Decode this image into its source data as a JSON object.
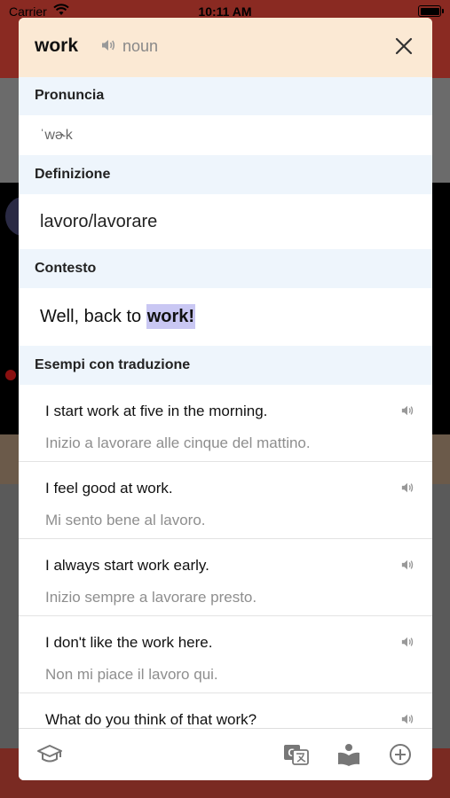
{
  "status_bar": {
    "carrier": "Carrier",
    "time": "10:11 AM"
  },
  "popup": {
    "word": "work",
    "part_of_speech": "noun",
    "sections": {
      "pronunciation_heading": "Pronuncia",
      "pronunciation": "ˈwɚk",
      "definition_heading": "Definizione",
      "definition": "lavoro/lavorare",
      "context_heading": "Contesto",
      "context_prefix": "Well, back to ",
      "context_highlight": "work!",
      "examples_heading": "Esempi con traduzione"
    },
    "examples": [
      {
        "en": "I start work at five in the morning.",
        "it": "Inizio a lavorare alle cinque del mattino."
      },
      {
        "en": "I feel good at work.",
        "it": "Mi sento bene al lavoro."
      },
      {
        "en": "I always start work early.",
        "it": "Inizio sempre a lavorare presto."
      },
      {
        "en": "I don't like the work here.",
        "it": "Non mi piace il lavoro qui."
      },
      {
        "en": "What do you think of that work?",
        "it": ""
      }
    ],
    "toolbar_icons": [
      "graduation-cap-icon",
      "translate-icon",
      "reader-icon",
      "add-circle-icon"
    ]
  },
  "colors": {
    "header_bg": "#fbe9d4",
    "section_bg": "#eef5fc",
    "highlight": "#c9c7f3"
  }
}
